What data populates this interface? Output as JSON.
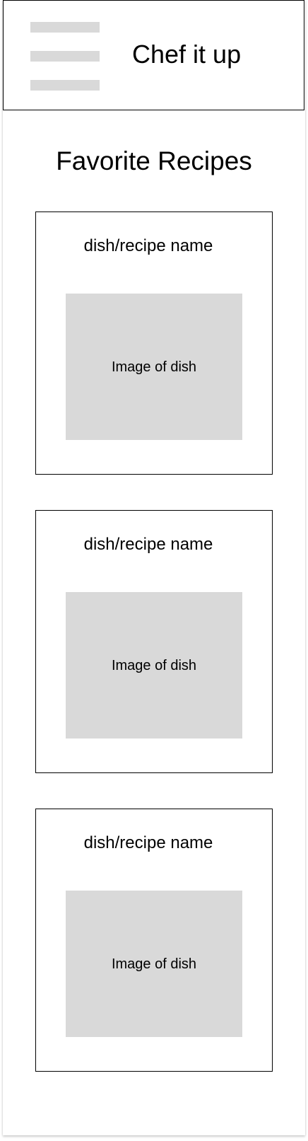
{
  "header": {
    "app_title": "Chef it up",
    "menu_icon": "hamburger-menu-icon"
  },
  "page": {
    "title": "Favorite Recipes"
  },
  "recipes": [
    {
      "name": "dish/recipe name",
      "image_label": "Image of dish"
    },
    {
      "name": "dish/recipe name",
      "image_label": "Image of dish"
    },
    {
      "name": "dish/recipe name",
      "image_label": "Image of dish"
    }
  ],
  "colors": {
    "placeholder_gray": "#d9d9d9",
    "border": "#000000",
    "background": "#ffffff"
  }
}
